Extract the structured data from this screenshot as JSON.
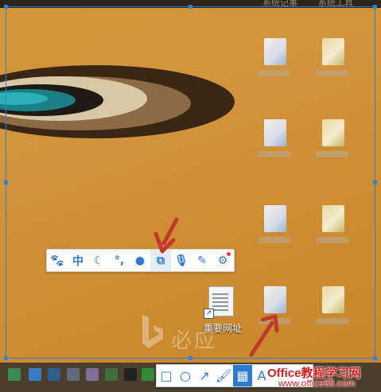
{
  "top_bar": {
    "left_text": "系统记事",
    "right_text": "系统工具"
  },
  "desktop_file": {
    "name": "重要网址"
  },
  "watermark": {
    "text": "必应"
  },
  "floating_toolbar": {
    "buttons": [
      {
        "name": "paw-icon",
        "glyph": "🐾"
      },
      {
        "name": "chinese-mode",
        "glyph": "中"
      },
      {
        "name": "moon-icon",
        "glyph": "☾"
      },
      {
        "name": "punctuation-icon",
        "glyph": "°,"
      },
      {
        "name": "user-icon",
        "glyph": "●"
      },
      {
        "name": "crop-icon",
        "glyph": "⧉"
      },
      {
        "name": "microphone-icon",
        "glyph": "🎙"
      },
      {
        "name": "pen-icon",
        "glyph": "✎"
      },
      {
        "name": "gear-icon",
        "glyph": "⚙"
      }
    ]
  },
  "annotation_toolbar": {
    "buttons": [
      {
        "name": "rectangle-tool",
        "glyph": "□"
      },
      {
        "name": "ellipse-tool",
        "glyph": "○"
      },
      {
        "name": "arrow-tool",
        "glyph": "↗"
      },
      {
        "name": "brush-tool",
        "glyph": "🖌"
      },
      {
        "name": "mosaic-tool",
        "glyph": "▦"
      },
      {
        "name": "text-tool",
        "glyph": "A"
      }
    ]
  },
  "brand": {
    "line1": "Office教程学习网",
    "line2": "www.office68.com"
  },
  "colors": {
    "accent": "#2b7ad6",
    "selection": "#2d7fd8",
    "arrow": "#c0392b",
    "brand": "#d61f1f"
  }
}
